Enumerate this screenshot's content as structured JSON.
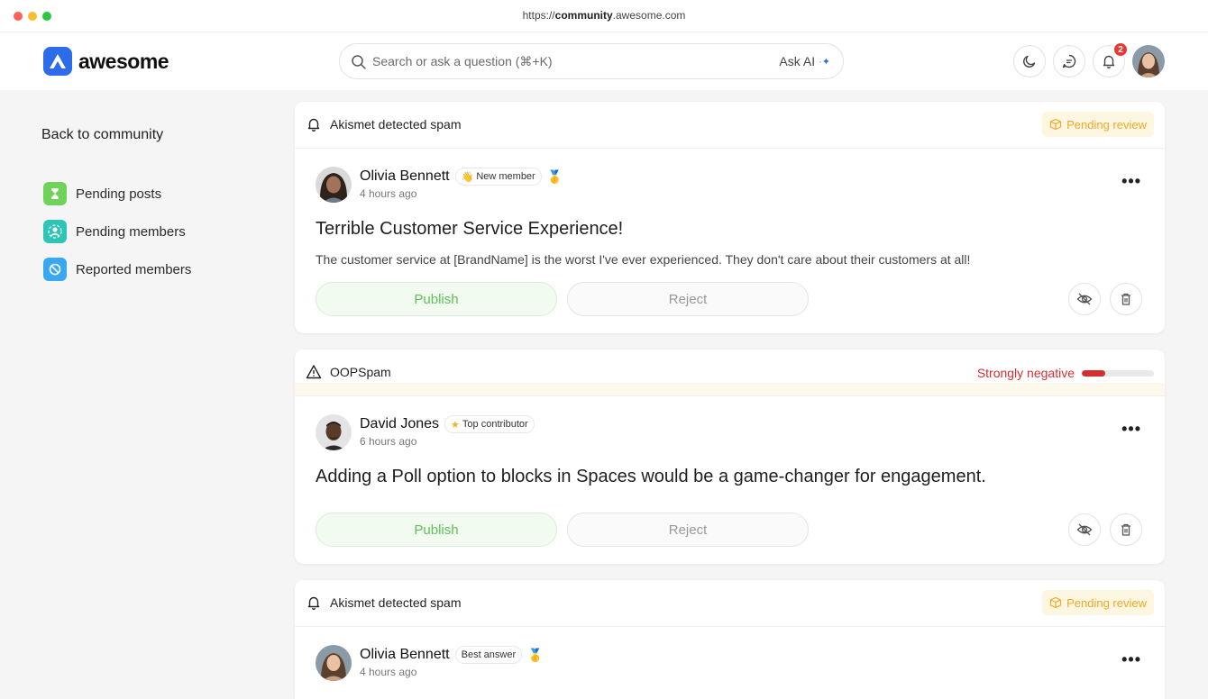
{
  "browser": {
    "url_prefix": "https://",
    "url_domain": "community",
    "url_suffix": ".awesome.com"
  },
  "header": {
    "brand": "awesome",
    "search_placeholder": "Search or ask a question (⌘+K)",
    "ask_ai": "Ask AI",
    "notification_count": "2"
  },
  "sidebar": {
    "back_label": "Back to community",
    "items": [
      {
        "label": "Pending posts",
        "color": "#6fd35a"
      },
      {
        "label": "Pending members",
        "color": "#2ec4b6"
      },
      {
        "label": "Reported members",
        "color": "#3aa8f0"
      }
    ]
  },
  "posts": [
    {
      "source": "Akismet detected spam",
      "status": "Pending review",
      "author": "Olivia Bennett",
      "tag": "New member",
      "time": "4 hours ago",
      "title": "Terrible Customer Service Experience!",
      "body": "The customer service at [BrandName] is the worst I've ever experienced. They don't care about their customers at all!",
      "publish": "Publish",
      "reject": "Reject"
    },
    {
      "source": "OOPSpam",
      "sentiment": "Strongly negative",
      "sentiment_level": 0.33,
      "author": "David Jones",
      "tag": "Top contributor",
      "time": "6 hours ago",
      "title": "Adding a Poll option to blocks in Spaces would be a game-changer for engagement.",
      "publish": "Publish",
      "reject": "Reject"
    },
    {
      "source": "Akismet detected spam",
      "status": "Pending review",
      "author": "Olivia Bennett",
      "tag": "Best answer",
      "time": "4 hours ago"
    }
  ]
}
